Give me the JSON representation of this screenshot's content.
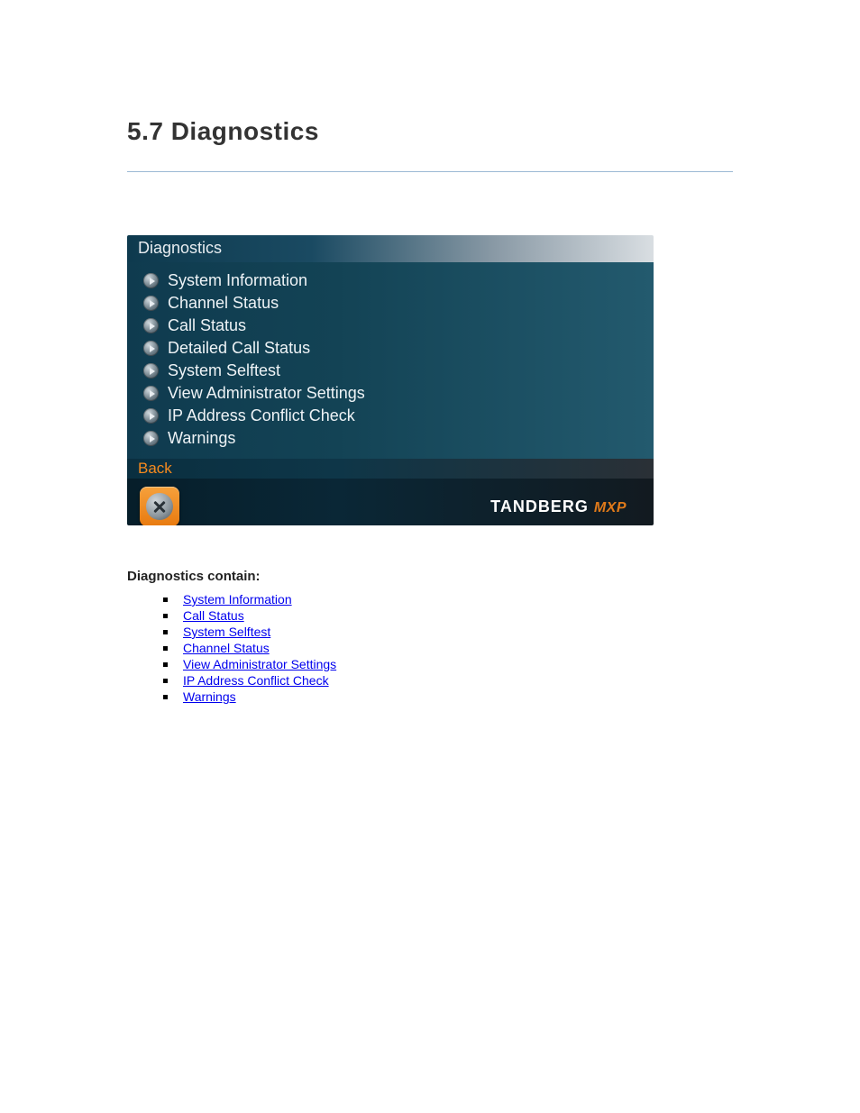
{
  "heading": "5.7 Diagnostics",
  "panel": {
    "title": "Diagnostics",
    "items": [
      {
        "label": "System Information"
      },
      {
        "label": "Channel Status"
      },
      {
        "label": "Call Status"
      },
      {
        "label": "Detailed Call Status"
      },
      {
        "label": "System Selftest"
      },
      {
        "label": "View Administrator Settings"
      },
      {
        "label": "IP Address Conflict Check"
      },
      {
        "label": "Warnings"
      }
    ],
    "back_label": "Back",
    "brand_main": "TANDBERG",
    "brand_sub": "MXP"
  },
  "links": {
    "heading": "Diagnostics contain:",
    "items": [
      {
        "label": "System Information"
      },
      {
        "label": "Call Status"
      },
      {
        "label": "System Selftest"
      },
      {
        "label": "Channel Status"
      },
      {
        "label": "View Administrator Settings"
      },
      {
        "label": "IP Address Conflict Check"
      },
      {
        "label": "Warnings"
      }
    ]
  }
}
